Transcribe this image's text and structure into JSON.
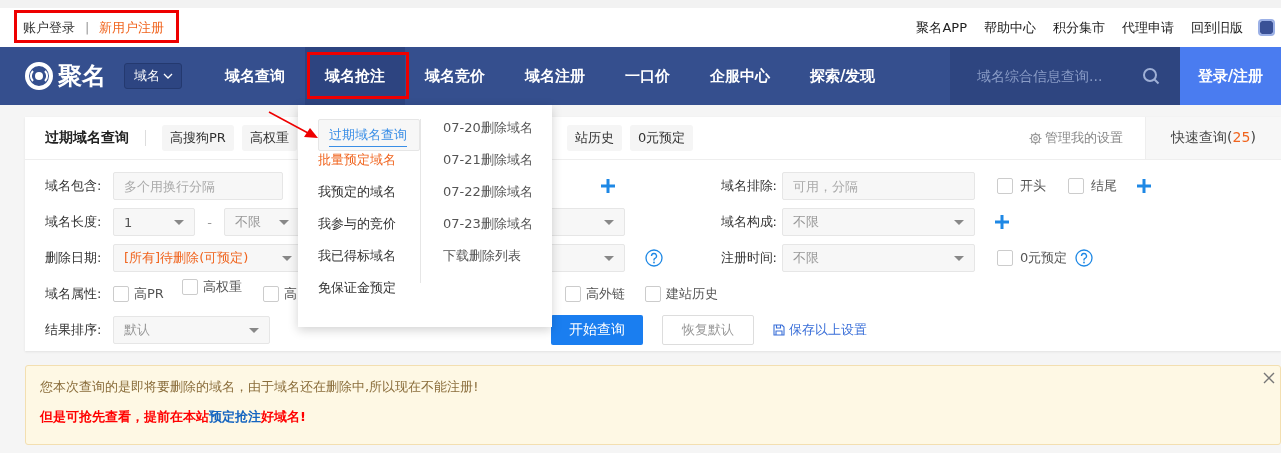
{
  "top_bar": {
    "account": [
      {
        "label": "账户登录",
        "kind": "login"
      },
      {
        "label": "新用户注册",
        "kind": "register"
      }
    ],
    "separator": "|",
    "links": [
      "聚名APP",
      "帮助中心",
      "积分集市",
      "代理申请",
      "回到旧版"
    ]
  },
  "nav": {
    "logo": "聚名",
    "category": "域名",
    "items": [
      {
        "label": "域名查询",
        "selected": false
      },
      {
        "label": "域名抢注",
        "selected": true
      },
      {
        "label": "域名竞价",
        "selected": false
      },
      {
        "label": "域名注册",
        "selected": false
      },
      {
        "label": "一口价",
        "selected": false
      },
      {
        "label": "企服中心",
        "selected": false
      },
      {
        "label": "探索/发现",
        "selected": false
      }
    ],
    "search": {
      "placeholder": "域名综合信息查询..."
    },
    "login_button": "登录/注册"
  },
  "dropdown": {
    "left": [
      {
        "label": "过期域名查询",
        "selected": true,
        "hot": false
      },
      {
        "label": "批量预定域名",
        "selected": false,
        "hot": true
      },
      {
        "label": "我预定的域名",
        "selected": false,
        "hot": false
      },
      {
        "label": "我参与的竞价",
        "selected": false,
        "hot": false
      },
      {
        "label": "我已得标域名",
        "selected": false,
        "hot": false
      },
      {
        "label": "免保证金预定",
        "selected": false,
        "hot": false
      }
    ],
    "right": [
      "07-20删除域名",
      "07-21删除域名",
      "07-22删除域名",
      "07-23删除域名",
      "下载删除列表"
    ]
  },
  "filter": {
    "title": "过期域名查询",
    "tabs": [
      "高搜狗PR",
      "高权重",
      "站历史",
      "0元预定"
    ],
    "manage": "管理我的设置",
    "quick": {
      "prefix": "快速查询(",
      "count": "25",
      "suffix": ")"
    }
  },
  "form": {
    "contains": {
      "label": "域名包含:",
      "placeholder": "多个用换行分隔"
    },
    "length": {
      "label": "域名长度:",
      "min": "1",
      "dash": "-",
      "max": "不限"
    },
    "delete_date": {
      "label": "删除日期:",
      "value": "[所有]待删除(可预定)"
    },
    "attributes": {
      "label": "域名属性:",
      "options": [
        {
          "label": "高PR",
          "checked": false
        },
        {
          "label": "高权重",
          "checked": false
        },
        {
          "label": "高",
          "checked": false
        },
        {
          "label": "高外链",
          "checked": false
        },
        {
          "label": "建站历史",
          "checked": false
        }
      ]
    },
    "sort": {
      "label": "结果排序:",
      "value": "默认"
    },
    "exclude": {
      "label": "域名排除:",
      "placeholder": "可用，分隔",
      "options": [
        {
          "label": "开头",
          "checked": false
        },
        {
          "label": "结尾",
          "checked": false
        }
      ]
    },
    "composition": {
      "label": "域名构成:",
      "value": "不限"
    },
    "reg_time": {
      "label": "注册时间:",
      "value": "不限",
      "options": [
        {
          "label": "0元预定",
          "checked": false
        }
      ]
    },
    "search_button": "开始查询",
    "reset_button": "恢复默认",
    "save_link": "保存以上设置"
  },
  "notice": {
    "line1": "您本次查询的是即将要删除的域名，由于域名还在删除中,所以现在不能注册!",
    "line2_before": "但是可抢先查看，提前在本站",
    "line2_link": "预定抢注",
    "line2_after": "好域名!"
  }
}
